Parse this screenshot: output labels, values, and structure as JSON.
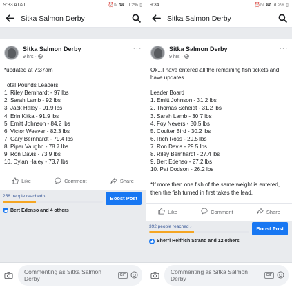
{
  "left": {
    "status": {
      "time": "9:33 AT&T",
      "icons": "⏰ℕ ☎ .ıl 2% ▯"
    },
    "topbar": {
      "title": "Sitka Salmon Derby"
    },
    "post": {
      "page_name": "Sitka Salmon Derby",
      "time": "9 hrs",
      "lines": [
        "*updated at 7:37am",
        "",
        "Total Pounds Leaders",
        "1. Riley Bernhardt - 97 lbs",
        "2. Sarah Lamb - 92 lbs",
        "3. Jack Haley - 91.9 lbs",
        "4. Erin Kitka - 91.9 lbs",
        "5. Emitt Johnson - 84.2 lbs",
        "6. Victor Weaver - 82.3 lbs",
        "7. Gary Bernhardt - 79.4 lbs",
        "8. Piper Vaughn - 78.7 lbs",
        "9. Ron Davis - 73.9 lbs",
        "10. Dylan Haley - 73.7 lbs"
      ]
    },
    "actions": {
      "like": "Like",
      "comment": "Comment",
      "share": "Share"
    },
    "reach": {
      "text": "258 people reached ›",
      "fraction": 0.33
    },
    "boost": "Boost Post",
    "reactions": "Bert Edenso and 4 others",
    "composer": {
      "placeholder": "Commenting as Sitka Salmon Derby",
      "gif": "GIF"
    }
  },
  "right": {
    "status": {
      "time": "9:34",
      "icons": "⏰ℕ ☎ .ıl 2% ▯"
    },
    "topbar": {
      "title": "Sitka Salmon Derby"
    },
    "post": {
      "page_name": "Sitka Salmon Derby",
      "time": "9 hrs",
      "lines": [
        "Ok...I have entered all the remaining fish tickets and have updates.",
        "",
        "Leader Board",
        "1. Emitt Johnson - 31.2 lbs",
        "2. Thomas Scheidt - 31.2 lbs",
        "3. Sarah Lamb - 30.7 lbs",
        "4. Foy Nevers - 30.5 lbs",
        "5. Coulter Bird - 30.2 lbs",
        "6. Rich Ross - 29.5 lbs",
        "7. Ron Davis - 29.5 lbs",
        "8. Riley Bernhardt - 27.4 lbs",
        "9. Bert Edenso - 27.2 lbs",
        "10. Pat Dodson - 26.2 lbs",
        "",
        "*If more then one fish of the same weight is entered, then the fish turned in first takes the lead."
      ]
    },
    "actions": {
      "like": "Like",
      "comment": "Comment",
      "share": "Share"
    },
    "reach": {
      "text": "392 people reached ›",
      "fraction": 0.45
    },
    "boost": "Boost Post",
    "reactions": "Sherri Helfrich Strand and 12 others",
    "composer": {
      "placeholder": "Commenting as Sitka Salmon Derby",
      "gif": "GIF"
    }
  },
  "colors": {
    "brand_blue": "#1877f2",
    "link_blue": "#385898",
    "reach_orange": "#f5a623",
    "feed_bg": "#e9ebee"
  }
}
